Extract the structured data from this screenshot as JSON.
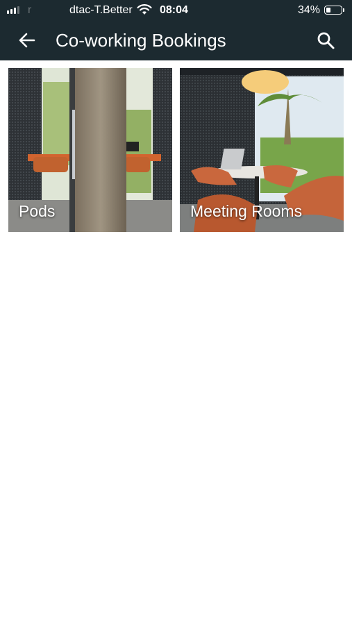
{
  "status_bar": {
    "carrier_faint": "r",
    "carrier": "dtac-T.Better",
    "time": "08:04",
    "battery_percent": "34%",
    "battery_level": 0.34,
    "signal_bars_active": 3,
    "icons": [
      "signal-icon",
      "wifi-icon",
      "battery-icon"
    ]
  },
  "app_bar": {
    "title": "Co-working Bookings",
    "back_icon": "arrow-left-icon",
    "search_icon": "search-icon",
    "background": "#1c2a30"
  },
  "categories": [
    {
      "label": "Pods"
    },
    {
      "label": "Meeting Rooms"
    }
  ]
}
